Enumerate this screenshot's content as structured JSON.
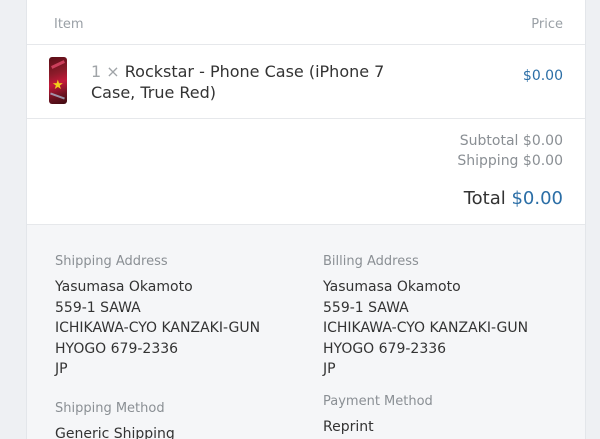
{
  "table_header": {
    "item_label": "Item",
    "price_label": "Price"
  },
  "line_items": [
    {
      "quantity": "1 ×",
      "name": "Rockstar - Phone Case (iPhone 7 Case, True Red)",
      "price": "$0.00",
      "thumbnail_icon": "phone-case-thumbnail"
    }
  ],
  "totals": {
    "subtotal_label": "Subtotal",
    "subtotal_value": "$0.00",
    "shipping_label": "Shipping",
    "shipping_value": "$0.00",
    "total_label": "Total",
    "total_value": "$0.00"
  },
  "shipping_address": {
    "label": "Shipping Address",
    "lines": [
      "Yasumasa Okamoto",
      "559-1 SAWA",
      "ICHIKAWA-CYO KANZAKI-GUN",
      "HYOGO 679-2336",
      "JP"
    ]
  },
  "billing_address": {
    "label": "Billing Address",
    "lines": [
      "Yasumasa Okamoto",
      "559-1 SAWA",
      "ICHIKAWA-CYO KANZAKI-GUN",
      "HYOGO 679-2336",
      "JP"
    ]
  },
  "shipping_method": {
    "label": "Shipping Method",
    "value": "Generic Shipping"
  },
  "payment_method": {
    "label": "Payment Method",
    "value": "Reprint"
  },
  "colors": {
    "accent": "#2b6ea6",
    "muted": "#8a8f94",
    "panel": "#f5f6f8"
  }
}
